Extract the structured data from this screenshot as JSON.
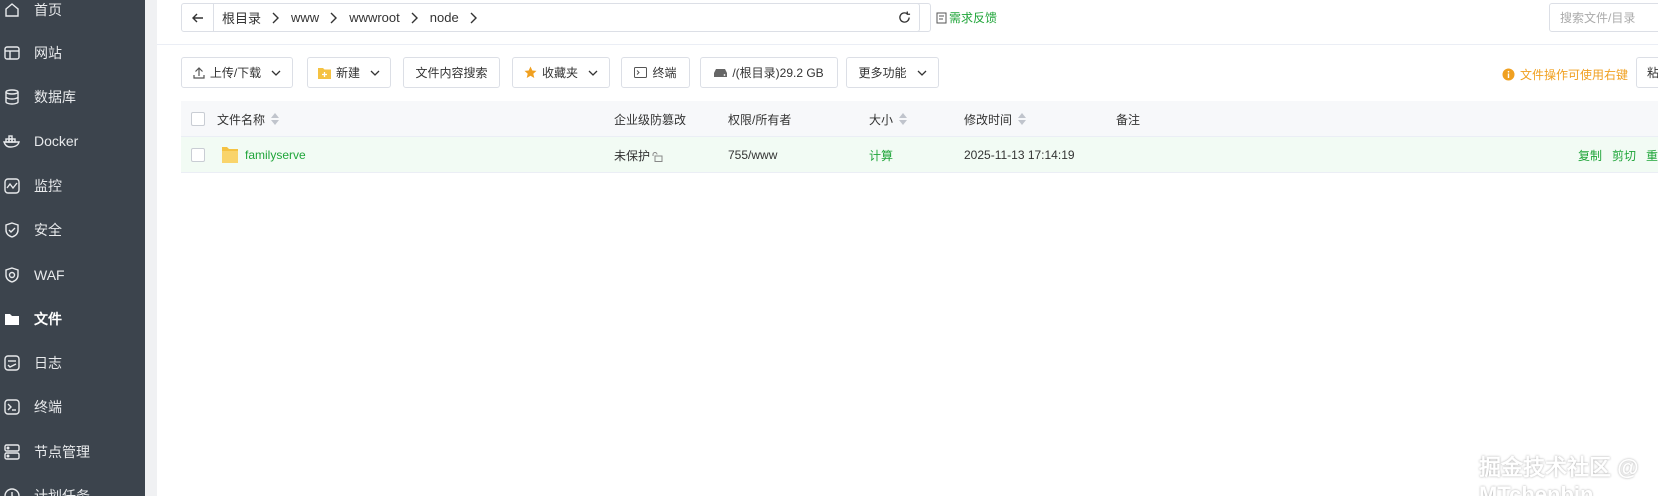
{
  "sidebar": {
    "items": [
      {
        "label": "首页",
        "icon": "home-icon"
      },
      {
        "label": "网站",
        "icon": "website-icon"
      },
      {
        "label": "数据库",
        "icon": "database-icon"
      },
      {
        "label": "Docker",
        "icon": "docker-icon"
      },
      {
        "label": "监控",
        "icon": "monitor-icon"
      },
      {
        "label": "安全",
        "icon": "shield-icon"
      },
      {
        "label": "WAF",
        "icon": "waf-icon"
      },
      {
        "label": "文件",
        "icon": "folder-icon",
        "active": true
      },
      {
        "label": "日志",
        "icon": "log-icon"
      },
      {
        "label": "终端",
        "icon": "terminal-icon"
      },
      {
        "label": "节点管理",
        "icon": "node-icon"
      },
      {
        "label": "计划任务",
        "icon": "schedule-icon"
      }
    ]
  },
  "breadcrumb": [
    "根目录",
    "www",
    "wwwroot",
    "node"
  ],
  "feedback_label": "需求反馈",
  "search": {
    "placeholder": "搜索文件/目录"
  },
  "toolbar": {
    "upload_download": "上传/下载",
    "new": "新建",
    "content_search": "文件内容搜索",
    "favorites": "收藏夹",
    "terminal": "终端",
    "disk": "/(根目录)29.2 GB",
    "more": "更多功能",
    "hint": "文件操作可使用右键",
    "paste": "粘"
  },
  "table": {
    "headers": {
      "name": "文件名称",
      "protect": "企业级防篡改",
      "perm": "权限/所有者",
      "size": "大小",
      "mtime": "修改时间",
      "remark": "备注"
    },
    "rows": [
      {
        "name": "familyserve",
        "protect": "未保护",
        "perm": "755/www",
        "size": "计算",
        "mtime": "2025-11-13 17:14:19",
        "remark": "",
        "ops": [
          "复制",
          "剪切",
          "重"
        ]
      }
    ]
  },
  "watermark": "掘金技术社区 @ MTchenbin",
  "colors": {
    "accent": "#20a53a",
    "sidebar": "#3c444d",
    "warning": "#f0a020"
  }
}
